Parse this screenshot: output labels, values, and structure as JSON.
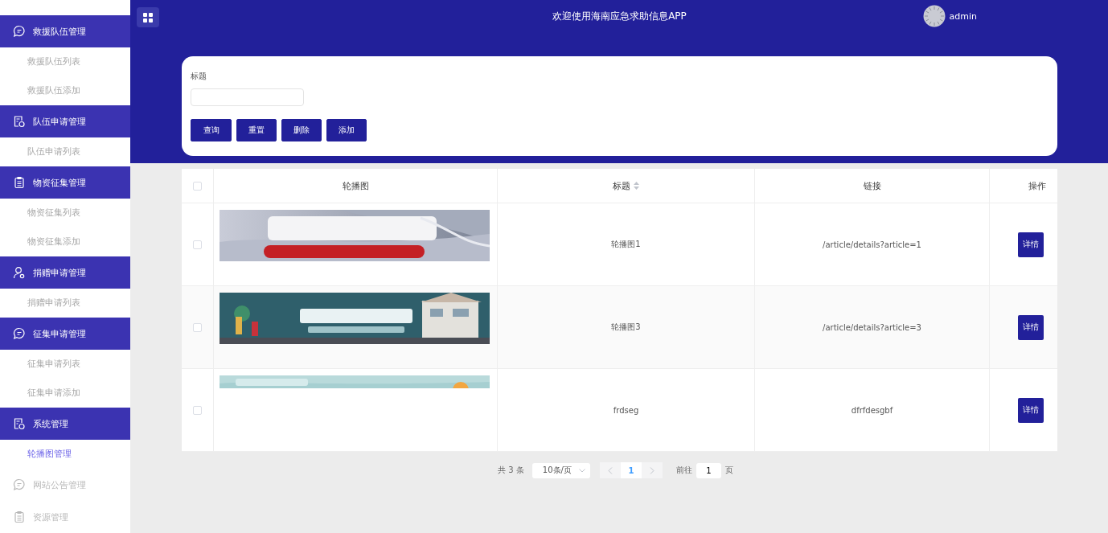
{
  "header": {
    "title": "欢迎使用海南应急求助信息APP",
    "user": "admin"
  },
  "sidebar": {
    "groups": [
      {
        "label": "救援队伍管理",
        "expanded": true,
        "items": [
          {
            "label": "救援队伍列表",
            "selected": false
          },
          {
            "label": "救援队伍添加",
            "selected": false
          }
        ]
      },
      {
        "label": "队伍申请管理",
        "expanded": true,
        "items": [
          {
            "label": "队伍申请列表",
            "selected": false
          }
        ]
      },
      {
        "label": "物资征集管理",
        "expanded": true,
        "items": [
          {
            "label": "物资征集列表",
            "selected": false
          },
          {
            "label": "物资征集添加",
            "selected": false
          }
        ]
      },
      {
        "label": "捐赠申请管理",
        "expanded": true,
        "items": [
          {
            "label": "捐赠申请列表",
            "selected": false
          }
        ]
      },
      {
        "label": "征集申请管理",
        "expanded": true,
        "items": [
          {
            "label": "征集申请列表",
            "selected": false
          },
          {
            "label": "征集申请添加",
            "selected": false
          }
        ]
      },
      {
        "label": "系统管理",
        "expanded": true,
        "items": [
          {
            "label": "轮播图管理",
            "selected": true
          }
        ]
      },
      {
        "label": "网站公告管理",
        "expanded": false
      },
      {
        "label": "资源管理",
        "expanded": false
      }
    ]
  },
  "search": {
    "fields": [
      {
        "label": "标题"
      }
    ],
    "buttons": [
      "查询",
      "重置",
      "删除",
      "添加"
    ]
  },
  "table": {
    "header_checked": false,
    "columns": [
      {
        "label": "轮播图"
      },
      {
        "label": "标题",
        "sortable": true
      },
      {
        "label": "链接"
      },
      {
        "label": "操作"
      }
    ],
    "rows": [
      {
        "checked": false,
        "title": "轮播图1",
        "link": "/article/details?article=1",
        "action": "详情"
      },
      {
        "checked": false,
        "title": "轮播图3",
        "link": "/article/details?article=3",
        "action": "详情"
      },
      {
        "checked": false,
        "title": "frdseg",
        "link": "dfrfdesgbf",
        "action": "详情"
      }
    ]
  },
  "pagination": {
    "total": "共 3 条",
    "page_size": "10条/页",
    "pages": [
      {
        "label": "1",
        "selected": true
      }
    ],
    "goto_label": "前往",
    "goto_value": "1",
    "goto_suffix": "页"
  }
}
